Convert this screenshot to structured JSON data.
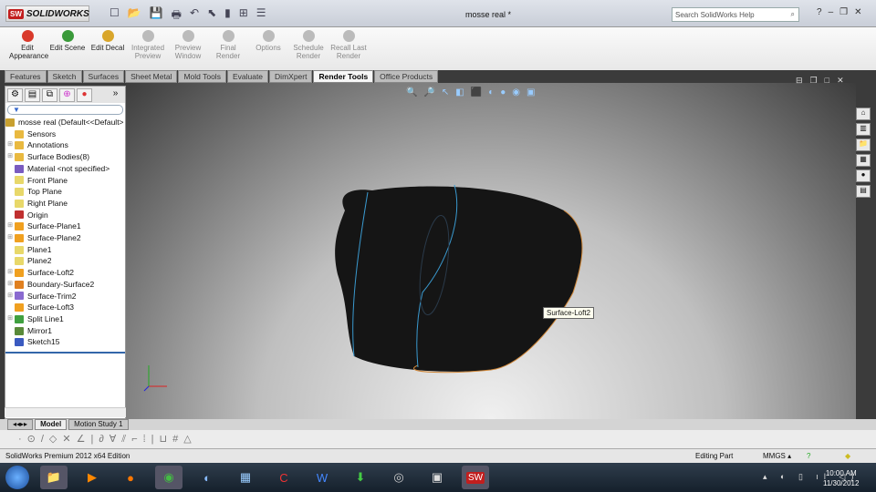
{
  "app": {
    "name": "SOLIDWORKS",
    "logo": "SW",
    "document_title": "mosse real *",
    "search_placeholder": "Search SolidWorks Help"
  },
  "ribbon": [
    {
      "label": "Edit Appearance",
      "icon": "appearance-icon",
      "enabled": true,
      "color": "#d93a2b"
    },
    {
      "label": "Edit Scene",
      "icon": "scene-icon",
      "enabled": true,
      "color": "#3a9a3a"
    },
    {
      "label": "Edit Decal",
      "icon": "decal-icon",
      "enabled": true,
      "color": "#d9a62b"
    },
    {
      "label": "Integrated Preview",
      "icon": "preview-icon",
      "enabled": false,
      "color": "#bbbbbb"
    },
    {
      "label": "Preview Window",
      "icon": "preview-window-icon",
      "enabled": false,
      "color": "#bbbbbb"
    },
    {
      "label": "Final Render",
      "icon": "render-icon",
      "enabled": false,
      "color": "#bbbbbb"
    },
    {
      "label": "Options",
      "icon": "options-icon",
      "enabled": false,
      "color": "#bbbbbb"
    },
    {
      "label": "Schedule Render",
      "icon": "schedule-icon",
      "enabled": false,
      "color": "#bbbbbb"
    },
    {
      "label": "Recall Last Render",
      "icon": "recall-icon",
      "enabled": false,
      "color": "#bbbbbb"
    }
  ],
  "tabs": [
    "Features",
    "Sketch",
    "Surfaces",
    "Sheet Metal",
    "Mold Tools",
    "Evaluate",
    "DimXpert",
    "Render Tools",
    "Office Products"
  ],
  "active_tab": "Render Tools",
  "tree": {
    "root": "mosse real  (Default<<Default>",
    "items": [
      {
        "label": "Sensors",
        "expand": false,
        "color": "#e9b940"
      },
      {
        "label": "Annotations",
        "expand": true,
        "color": "#e9b940"
      },
      {
        "label": "Surface Bodies(8)",
        "expand": true,
        "color": "#e9b940"
      },
      {
        "label": "Material <not specified>",
        "expand": false,
        "color": "#7a5bbf"
      },
      {
        "label": "Front Plane",
        "expand": false,
        "color": "#e8d86a"
      },
      {
        "label": "Top Plane",
        "expand": false,
        "color": "#e8d86a"
      },
      {
        "label": "Right Plane",
        "expand": false,
        "color": "#e8d86a"
      },
      {
        "label": "Origin",
        "expand": false,
        "color": "#c03030"
      },
      {
        "label": "Surface-Plane1",
        "expand": true,
        "color": "#f0a020"
      },
      {
        "label": "Surface-Plane2",
        "expand": true,
        "color": "#f0a020"
      },
      {
        "label": "Plane1",
        "expand": false,
        "color": "#e8d86a"
      },
      {
        "label": "Plane2",
        "expand": false,
        "color": "#e8d86a"
      },
      {
        "label": "Surface-Loft2",
        "expand": true,
        "color": "#f0a020"
      },
      {
        "label": "Boundary-Surface2",
        "expand": true,
        "color": "#e08020"
      },
      {
        "label": "Surface-Trim2",
        "expand": true,
        "color": "#8a6ad0"
      },
      {
        "label": "Surface-Loft3",
        "expand": false,
        "color": "#f0a020"
      },
      {
        "label": "Split Line1",
        "expand": true,
        "color": "#40a040"
      },
      {
        "label": "Mirror1",
        "expand": false,
        "color": "#5a8a3a"
      },
      {
        "label": "Sketch15",
        "expand": false,
        "color": "#3a5ac0"
      }
    ]
  },
  "tooltip": "Surface-Loft2",
  "bottom_tabs": [
    "Model",
    "Motion Study 1"
  ],
  "status": {
    "edition": "SolidWorks Premium 2012 x64 Edition",
    "mode": "Editing Part",
    "units": "MMGS"
  },
  "clock": {
    "time": "10:00 AM",
    "date": "11/30/2012"
  }
}
